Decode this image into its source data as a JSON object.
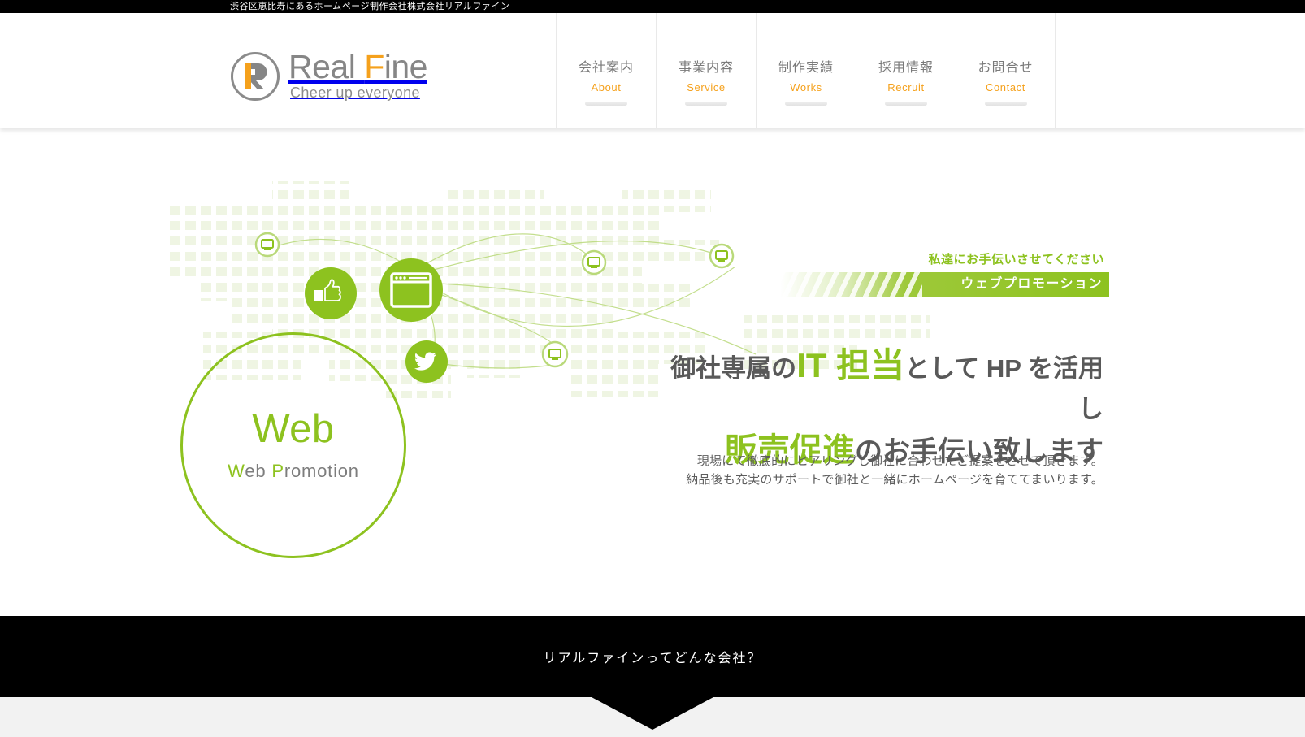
{
  "topbar": {
    "tagline": "渋谷区恵比寿にあるホームページ制作会社株式会社リアルファイン"
  },
  "brand": {
    "name": "Real Fine",
    "name_part1": "Real ",
    "name_accent": "F",
    "name_part2": "ine",
    "tagline": "Cheer up everyone",
    "logo_icon": "real-fine-r-logo"
  },
  "nav": {
    "items": [
      {
        "ja": "会社案内",
        "en": "About"
      },
      {
        "ja": "事業内容",
        "en": "Service"
      },
      {
        "ja": "制作実績",
        "en": "Works"
      },
      {
        "ja": "採用情報",
        "en": "Recruit"
      },
      {
        "ja": "お問合せ",
        "en": "Contact"
      }
    ]
  },
  "hero": {
    "circle": {
      "title": "Web",
      "subtitle_accent1": "W",
      "subtitle_rest1": "eb",
      "subtitle_accent2": "P",
      "subtitle_rest2": "romotion",
      "subtitle_full": "Web Promotion"
    },
    "promo": {
      "caption": "私達にお手伝いさせてください",
      "bar_label": "ウェブプロモーション"
    },
    "headline_line1_a": "御社専属の",
    "headline_line1_green": "IT 担当",
    "headline_line1_b": "として HP を活用し",
    "headline_line2_green": "販売促進",
    "headline_line2_b": "のお手伝い致します",
    "lead_line1": "現場にて徹底的にヒアリングし御社に合わせたご提案をさせて頂きます。",
    "lead_line2": "納品後も充実のサポートで御社と一緒にホームページを育ててまいります。",
    "icons": [
      {
        "name": "thumbs-up-icon"
      },
      {
        "name": "browser-window-icon"
      },
      {
        "name": "twitter-bird-icon"
      },
      {
        "name": "monitor-node-icon"
      }
    ]
  },
  "band": {
    "question": "リアルファインってどんな会社？",
    "arrow": "down-arrow-icon"
  },
  "colors": {
    "green": "#8dc21f",
    "orange": "#f5a11c",
    "gray_text": "#7a7a7a",
    "black": "#000000"
  }
}
